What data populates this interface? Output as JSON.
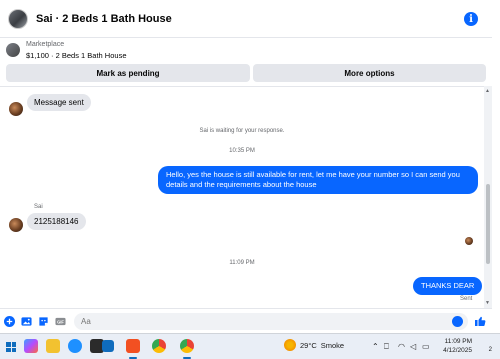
{
  "header": {
    "title": "Sai · 2 Beds 1 Bath House",
    "info_icon": "i"
  },
  "marketplace": {
    "label": "Marketplace",
    "listing": "$1,100 · 2 Beds 1 Bath House",
    "pending_button": "Mark as pending",
    "more_button": "More options"
  },
  "conversation": {
    "msg_sent_bubble": "Message sent",
    "waiting_text": "Sai is waiting for your response.",
    "time_1": "10:35 PM",
    "outgoing_1": "Hello, yes the house is still available for rent, let me have your number so I can send you details and the requirements about the house",
    "sender_name": "Sai",
    "incoming_number": "2125188146",
    "time_2": "11:09 PM",
    "outgoing_2": "THANKS DEAR",
    "sent_status": "Sent"
  },
  "composer": {
    "placeholder": "Aa"
  },
  "taskbar": {
    "temperature": "29°C",
    "weather": "Smoke",
    "time": "11:09 PM",
    "date": "4/12/2025",
    "notifications": "2"
  },
  "colors": {
    "accent": "#0866ff",
    "bubble_in": "#e4e6eb"
  }
}
